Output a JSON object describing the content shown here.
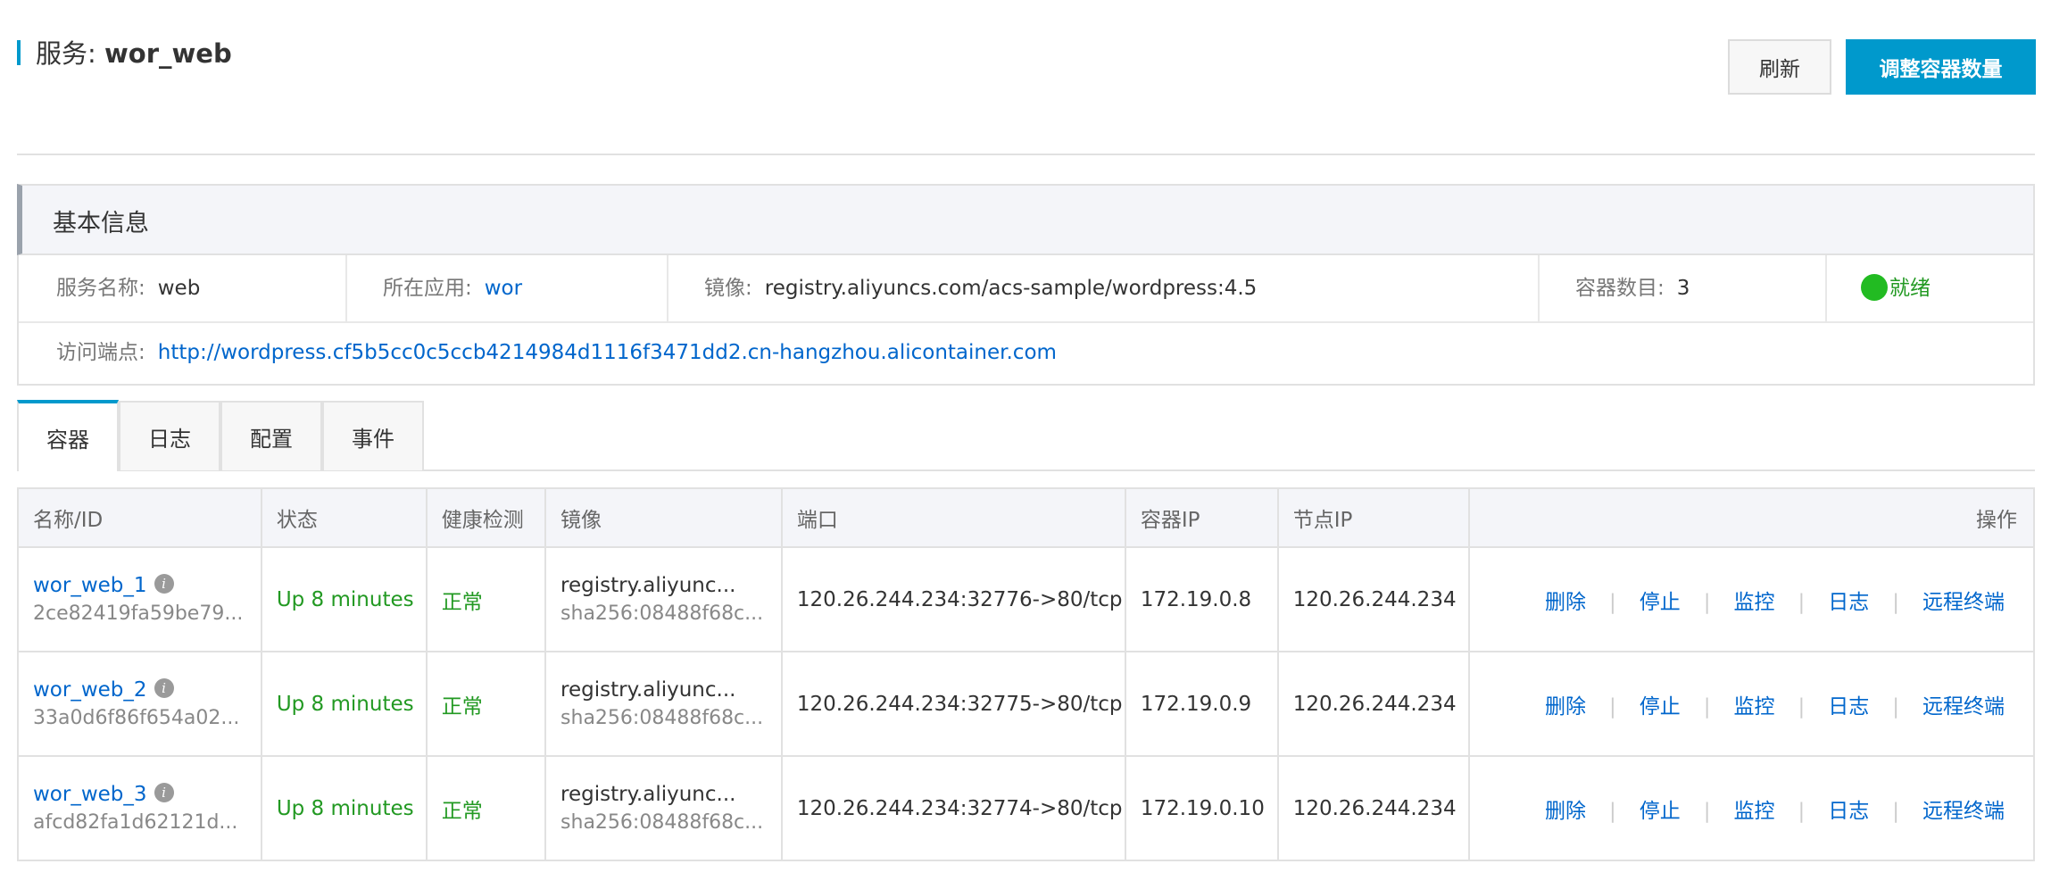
{
  "header": {
    "title_prefix": "服务:",
    "service_name": "wor_web",
    "refresh_label": "刷新",
    "scale_label": "调整容器数量"
  },
  "basic_info": {
    "section_title": "基本信息",
    "service_name_label": "服务名称:",
    "service_name_value": "web",
    "app_label": "所在应用:",
    "app_value": "wor",
    "image_label": "镜像:",
    "image_value": "registry.aliyuncs.com/acs-sample/wordpress:4.5",
    "container_count_label": "容器数目:",
    "container_count_value": "3",
    "status_value": "就绪",
    "endpoint_label": "访问端点:",
    "endpoint_value": "http://wordpress.cf5b5cc0c5ccb4214984d1116f3471dd2.cn-hangzhou.alicontainer.com",
    "status_color": "#22bb22"
  },
  "tabs": [
    {
      "label": "容器",
      "active": true
    },
    {
      "label": "日志",
      "active": false
    },
    {
      "label": "配置",
      "active": false
    },
    {
      "label": "事件",
      "active": false
    }
  ],
  "table": {
    "columns": [
      "名称/ID",
      "状态",
      "健康检测",
      "镜像",
      "端口",
      "容器IP",
      "节点IP",
      "操作"
    ],
    "rows": [
      {
        "name": "wor_web_1",
        "id": "2ce82419fa59be79...",
        "status": "Up 8 minutes",
        "health": "正常",
        "image": "registry.aliyunc...",
        "image_sha": "sha256:08488f68c...",
        "port": "120.26.244.234:32776->80/tcp",
        "container_ip": "172.19.0.8",
        "node_ip": "120.26.244.234"
      },
      {
        "name": "wor_web_2",
        "id": "33a0d6f86f654a02...",
        "status": "Up 8 minutes",
        "health": "正常",
        "image": "registry.aliyunc...",
        "image_sha": "sha256:08488f68c...",
        "port": "120.26.244.234:32775->80/tcp",
        "container_ip": "172.19.0.9",
        "node_ip": "120.26.244.234"
      },
      {
        "name": "wor_web_3",
        "id": "afcd82fa1d62121d...",
        "status": "Up 8 minutes",
        "health": "正常",
        "image": "registry.aliyunc...",
        "image_sha": "sha256:08488f68c...",
        "port": "120.26.244.234:32774->80/tcp",
        "container_ip": "172.19.0.10",
        "node_ip": "120.26.244.234"
      }
    ],
    "actions": [
      "删除",
      "停止",
      "监控",
      "日志",
      "远程终端"
    ]
  },
  "colors": {
    "accent": "#0099cc",
    "link": "#0066cc",
    "success": "#229922"
  }
}
